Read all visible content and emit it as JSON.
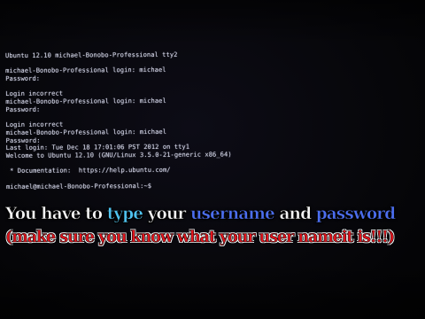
{
  "terminal": {
    "lines": [
      "Ubuntu 12.10 michael-Bonobo-Professional tty2",
      "",
      "michael-Bonobo-Professional login: michael",
      "Password:",
      "",
      "Login incorrect",
      "michael-Bonobo-Professional login: michael",
      "Password:",
      "",
      "Login incorrect",
      "michael-Bonobo-Professional login: michael",
      "Password:",
      "Last login: Tue Dec 18 17:01:06 PST 2012 on tty1",
      "Welcome to Ubuntu 12.10 (GNU/Linux 3.5.0-21-generic x86_64)",
      "",
      " * Documentation:  https://help.ubuntu.com/",
      "",
      "michael@michael-Bonobo-Professional:~$"
    ]
  },
  "caption": {
    "line1": {
      "part1": "You have to ",
      "part2": "type",
      "part3": " your ",
      "part4": "username",
      "part5": " and ",
      "part6": "password"
    },
    "line2": "(make sure you know what your user nameit is!!!)"
  },
  "colors": {
    "terminal_text": "#d4d6e6",
    "caption_white": "#f4f4f4",
    "caption_cyan": "#4ec3f0",
    "caption_blue": "#4b6ef0",
    "caption_red": "#e2141c"
  }
}
